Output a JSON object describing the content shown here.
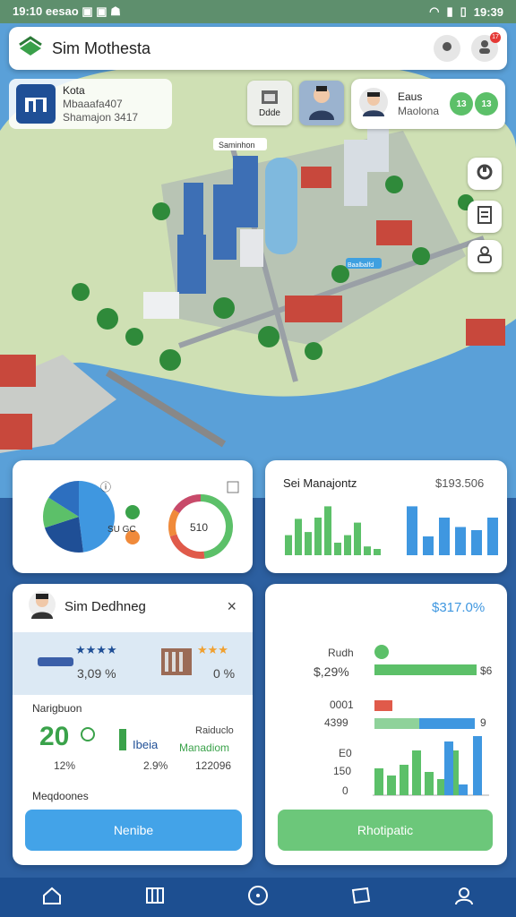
{
  "status_bar": {
    "left": "19:10 eesao ▣ ▣ ☗",
    "time": "19:39"
  },
  "app_bar": {
    "title": "Sim Mothesta",
    "notif_count": "17"
  },
  "city": {
    "name": "Kota",
    "line2": "Mbaaafa407",
    "line3": "Shamajon 3417"
  },
  "action_tile": {
    "label": "Ddde"
  },
  "player": {
    "name": "Eaus",
    "sub": "Maolona",
    "badge1": "13",
    "badge2": "13"
  },
  "map_labels": {
    "tag1": "Saminhon",
    "tag2": "Baalbalfd"
  },
  "panel_pie": {
    "donut_center": "510",
    "mid_label": "SU GC"
  },
  "panel_bars": {
    "title": "Sei Manajontz",
    "value": "$193.506"
  },
  "manager": {
    "name": "Sim Dedhneg",
    "row1_value": "3,09 %",
    "row2_value": "0 %",
    "section1": "Narigbuon",
    "big_value": "20",
    "percent1": "12%",
    "percent2": "2.9%",
    "label_mid": "Ibeia",
    "label_right_top": "Raiduclo",
    "label_right": "Manadiom",
    "value_right": "122096",
    "section2": "Meqdoones",
    "button": "Nenibe"
  },
  "stats": {
    "value": "$317.0%",
    "row1_label": "Rudh",
    "row1_value": "$,29%",
    "row1_end": "$6",
    "row2_label": "0001",
    "row2_value": "4399",
    "row2_end": "9",
    "row3_label": "E0",
    "row4_label": "150",
    "row5_label": "0",
    "button": "Rhotipatic"
  },
  "chart_data": [
    {
      "type": "bar",
      "title": "Sei Manajontz",
      "series": [
        {
          "values": [
            32,
            58,
            37,
            60,
            78,
            20,
            32,
            52,
            14,
            10
          ]
        },
        {
          "values": [
            78,
            30,
            60,
            45,
            40,
            60
          ]
        }
      ],
      "ylim": [
        0,
        100
      ]
    },
    {
      "type": "pie",
      "values": [
        48,
        22,
        14,
        16
      ]
    },
    {
      "type": "bar",
      "series": [
        {
          "name": "green",
          "values": [
            30,
            22,
            34,
            50,
            26,
            18,
            50
          ]
        },
        {
          "name": "blue",
          "values": [
            60,
            12,
            66
          ]
        }
      ]
    }
  ],
  "colors": {
    "green": "#5cc069",
    "blue": "#3f97e0",
    "red": "#e05a4a",
    "nav": "#1d4f91"
  },
  "nav_icons": [
    "home-icon",
    "map-icon",
    "compass-icon",
    "ticket-icon",
    "profile-icon"
  ]
}
